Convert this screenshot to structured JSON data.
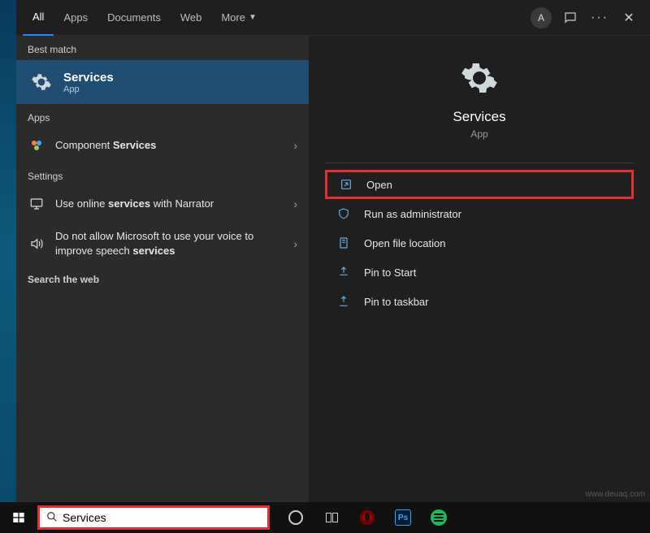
{
  "tabs": {
    "all": "All",
    "apps": "Apps",
    "documents": "Documents",
    "web": "Web",
    "more": "More"
  },
  "header": {
    "avatar_initial": "A"
  },
  "sections": {
    "best_match": "Best match",
    "apps": "Apps",
    "settings": "Settings",
    "search_web": "Search the web"
  },
  "best_match": {
    "title": "Services",
    "subtitle": "App"
  },
  "apps_results": {
    "component_services_pre": "Component ",
    "component_services_bold": "Services"
  },
  "settings_results": {
    "narrator_pre": "Use online ",
    "narrator_bold": "services",
    "narrator_post": " with Narrator",
    "speech_pre": "Do not allow Microsoft to use your voice to improve speech ",
    "speech_bold": "services"
  },
  "preview": {
    "title": "Services",
    "subtitle": "App"
  },
  "actions": {
    "open": "Open",
    "run_admin": "Run as administrator",
    "open_location": "Open file location",
    "pin_start": "Pin to Start",
    "pin_taskbar": "Pin to taskbar"
  },
  "taskbar": {
    "search_value": "Services",
    "ps_label": "Ps"
  },
  "watermark": "www.deuaq.com"
}
